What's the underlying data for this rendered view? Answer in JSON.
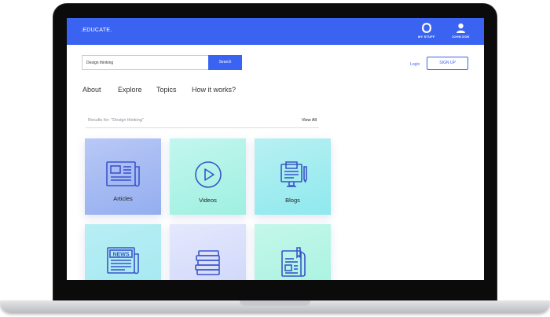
{
  "header": {
    "brand": ".EDUCATE.",
    "nav": [
      {
        "label": "MY STUFF",
        "icon": "box-icon"
      },
      {
        "label": "JOHN DOE",
        "icon": "user-icon"
      }
    ],
    "accent_color": "#3b63f2"
  },
  "search": {
    "value": "Design thinking",
    "button_label": "Search"
  },
  "auth": {
    "login_label": "Login",
    "signup_label": "SIGN UP"
  },
  "menu": [
    "About",
    "Explore",
    "Topics",
    "How it works?"
  ],
  "results": {
    "text": "Results for: \"Design thinking\"",
    "view_all_label": "View All"
  },
  "cards": [
    {
      "label": "Articles",
      "icon": "newspaper-icon"
    },
    {
      "label": "Videos",
      "icon": "play-icon"
    },
    {
      "label": "Blogs",
      "icon": "blog-icon"
    },
    {
      "label": "",
      "icon": "news-icon",
      "icon_text": "NEWS"
    },
    {
      "label": "",
      "icon": "books-icon"
    },
    {
      "label": "",
      "icon": "magazine-icon"
    }
  ]
}
